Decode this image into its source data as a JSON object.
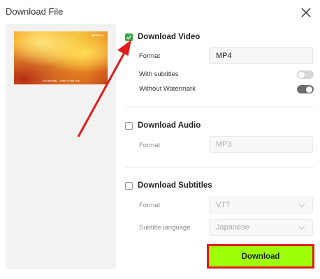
{
  "dialog": {
    "title": "Download File",
    "close_icon": "close-icon"
  },
  "preview": {
    "subtitle_text": "You're pretti... a fan of this one",
    "watermark_text": "NETFLIX"
  },
  "video": {
    "label": "Download Video",
    "checked": true,
    "format_label": "Format",
    "format_value": "MP4",
    "subtitles_label": "With subtitles",
    "subtitles_on": false,
    "watermark_label": "Without Watermark",
    "watermark_on": true
  },
  "audio": {
    "label": "Download Audio",
    "checked": false,
    "format_label": "Format",
    "format_value": "MP3"
  },
  "subtitles": {
    "label": "Download Subtitles",
    "checked": false,
    "format_label": "Format",
    "format_value": "VTT",
    "language_label": "Subtitle language",
    "language_value": "Japanese"
  },
  "actions": {
    "download_label": "Download"
  },
  "colors": {
    "accent_green": "#9dff08",
    "highlight_red": "#e01b1b",
    "check_green": "#35a844"
  }
}
